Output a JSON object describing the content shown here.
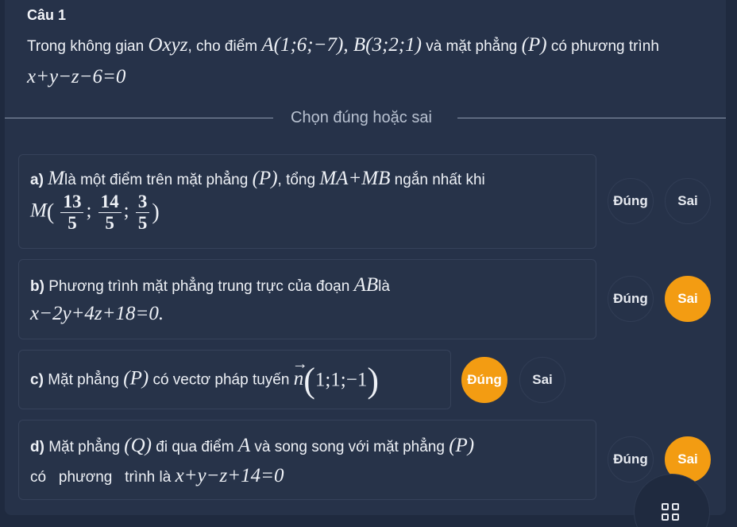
{
  "question": {
    "label": "Câu 1",
    "text_1": "Trong không gian ",
    "space": "Oxyz",
    "text_2": ", cho điểm ",
    "pointA": "A(1;6;−7)",
    "sep": ",  ",
    "pointB": "B(3;2;1)",
    "text_3": " và mặt phẳng ",
    "planeP": "(P)",
    "text_4": " có phương trình ",
    "equation": "x+y−z−6=0"
  },
  "divider_text": "Chọn đúng hoặc sai",
  "statements": {
    "a": {
      "prefix": "a) ",
      "var": "M",
      "text_1": "là một điểm trên mặt phẳng ",
      "plane": "(P)",
      "text_2": ", tổng ",
      "sum": "MA+MB",
      "text_3": " ngắn nhất khi",
      "point": "M",
      "open": "(",
      "n1": "13",
      "d1": "5",
      "n2": "14",
      "d2": "5",
      "n3": "3",
      "d3": "5",
      "semi": ";",
      "close": ")",
      "true_label": "Đúng",
      "false_label": "Sai",
      "selected": "none"
    },
    "b": {
      "prefix": "b) ",
      "text_1": "Phương trình mặt phẳng trung trực của đoạn ",
      "segment": "AB",
      "text_2": "là",
      "equation": "x−2y+4z+18=0.",
      "true_label": "Đúng",
      "false_label": "Sai",
      "selected": "false"
    },
    "c": {
      "prefix": "c) ",
      "text_1": "Mặt phẳng ",
      "plane": "(P)",
      "text_2": " có vectơ pháp tuyến ",
      "vector": "n",
      "arrow": "→",
      "coords": "1;1;−1",
      "open": "(",
      "close": ")",
      "true_label": "Đúng",
      "false_label": "Sai",
      "selected": "true"
    },
    "d": {
      "prefix": "d) ",
      "text_1": "Mặt phẳng ",
      "plane_q": "(Q)",
      "text_2": " đi qua điểm ",
      "point": "A",
      "text_3": " và song song với mặt phẳng ",
      "plane_p": "(P)",
      "text_4": "có   phương   trình là ",
      "equation": "x+y−z+14=0",
      "true_label": "Đúng",
      "false_label": "Sai",
      "selected": "false"
    }
  },
  "colors": {
    "accent": "#f39c12",
    "background": "#1f2a3f",
    "panel": "#263249"
  },
  "icons": {
    "menu": "grid-icon"
  }
}
